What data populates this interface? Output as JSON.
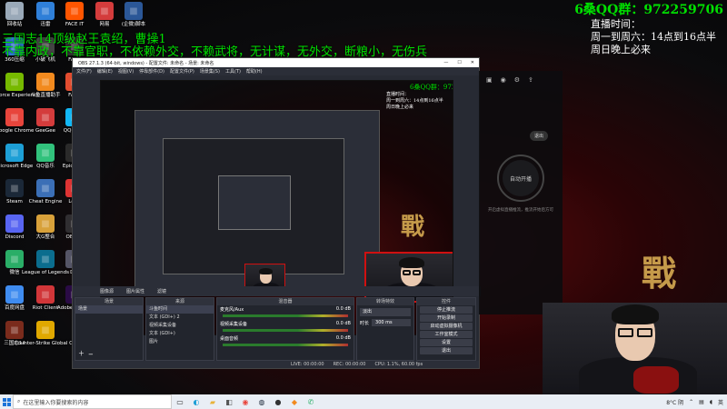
{
  "overlay": {
    "qq_group": "6桑QQ群：972259706",
    "schedule": [
      "直播时间：",
      "周一到周六：14点到16点半",
      "周日晚上必来"
    ],
    "banner_line1": "三国志14顶级赵王袁绍，曹操1",
    "banner_line2": "不靠内政，不靠官职，不依赖外交，不赖武将，无计谋，无外交，断粮小，无伤兵"
  },
  "desktop_icons": {
    "col1": [
      {
        "label": "回收站",
        "icon": "recycle-bin-icon",
        "color": "#9aa9b8"
      },
      {
        "label": "360压缩",
        "icon": "archive-icon",
        "color": "#2f7fd8"
      },
      {
        "label": "GeForce Experience",
        "icon": "geforce-icon",
        "color": "#76b900"
      },
      {
        "label": "Google Chrome",
        "icon": "chrome-icon",
        "color": "#e8453c"
      },
      {
        "label": "Microsoft Edge",
        "icon": "edge-icon",
        "color": "#1d9fd6"
      },
      {
        "label": "Steam",
        "icon": "steam-icon",
        "color": "#1b2838"
      },
      {
        "label": "Discord",
        "icon": "discord-icon",
        "color": "#5865f2"
      },
      {
        "label": "微信",
        "icon": "wechat-icon",
        "color": "#2aae67"
      },
      {
        "label": "百度网盘",
        "icon": "baidu-netdisk-icon",
        "color": "#3f8cf0"
      },
      {
        "label": "三国志14",
        "icon": "game-icon",
        "color": "#7a2b1c"
      }
    ],
    "col2": [
      {
        "label": "迅雷",
        "icon": "thunder-icon",
        "color": "#2f7fd8"
      },
      {
        "label": "小破飞机",
        "icon": "plane-icon",
        "color": "#444"
      },
      {
        "label": "斗鱼直播助手",
        "icon": "douyu-icon",
        "color": "#f28a1e"
      },
      {
        "label": "GeeGee",
        "icon": "geegee-icon",
        "color": "#d43c3c"
      },
      {
        "label": "QQ音乐",
        "icon": "qqmusic-icon",
        "color": "#31c27c"
      },
      {
        "label": "Cheat Engine",
        "icon": "cheat-engine-icon",
        "color": "#3b6fb6"
      },
      {
        "label": "大G整合",
        "icon": "tool-icon",
        "color": "#d8a13a"
      },
      {
        "label": "League of Legends",
        "icon": "lol-icon",
        "color": "#0b6d8e"
      },
      {
        "label": "Riot Client",
        "icon": "riot-icon",
        "color": "#d13639"
      },
      {
        "label": "Counter-Strike Global Off",
        "icon": "cs-icon",
        "color": "#e0a800"
      }
    ],
    "col3": [
      {
        "label": "FACE IT",
        "icon": "faceit-icon",
        "color": "#ff5500"
      },
      {
        "label": "FACE",
        "icon": "app-icon",
        "color": "#333"
      },
      {
        "label": "FACE",
        "icon": "app-icon",
        "color": "#e24c2f"
      },
      {
        "label": "QQ 2020",
        "icon": "qq-icon",
        "color": "#12b7f5"
      },
      {
        "label": "Epic Gam",
        "icon": "epic-icon",
        "color": "#2a2a2a"
      },
      {
        "label": "Loop",
        "icon": "loop-icon",
        "color": "#d33"
      },
      {
        "label": "OBS St",
        "icon": "obs-icon",
        "color": "#302e31"
      },
      {
        "label": "Dor",
        "icon": "app-icon",
        "color": "#556"
      },
      {
        "label": "Adobe Premie",
        "icon": "premiere-icon",
        "color": "#2a0b45"
      }
    ],
    "row_top": [
      {
        "label": "网易",
        "icon": "netease-icon",
        "color": "#d43c3c"
      },
      {
        "label": "(企微)脚本",
        "icon": "word-icon",
        "color": "#2b5797"
      }
    ]
  },
  "obs": {
    "title": "OBS 27.1.3 (64-bit, windows) - 配置文件: 未命名 - 场景: 未命名",
    "menu": [
      "文件(F)",
      "编辑(E)",
      "视图(V)",
      "停靠部件(D)",
      "配置文件(P)",
      "场景集(S)",
      "工具(T)",
      "帮助(H)"
    ],
    "source_toolbar": [
      "图片属性",
      "滤镜",
      "图像源"
    ],
    "scenes_header": "场景",
    "scenes": [
      "场景"
    ],
    "sources_header": "来源",
    "sources": [
      "斗鱼时间",
      "文本 (GDI+) 2",
      "视频采集设备",
      "文本 (GDI+)",
      "图片"
    ],
    "mixer_header": "混音器",
    "mixer": [
      {
        "name": "麦克风/Aux",
        "db": "0.0 dB"
      },
      {
        "name": "视频采集设备",
        "db": "0.0 dB"
      },
      {
        "name": "桌面音频",
        "db": "0.0 dB"
      }
    ],
    "transitions_header": "转场特效",
    "transition_value": "淡出",
    "duration_label": "时长",
    "duration_value": "300 ms",
    "controls_header": "控件",
    "controls": [
      "停止推流",
      "开始录制",
      "启动虚拟摄像机",
      "工作室模式",
      "设置",
      "退出"
    ],
    "status": [
      "LIVE: 00:00:00",
      "REC: 00:00:00",
      "CPU: 1.1%, 60.00 fps"
    ]
  },
  "douyu_panel": {
    "stop_label": "退出",
    "center_label": "自动开播",
    "desc": "开启虚拟直播推流，推流开始后方可"
  },
  "taskbar": {
    "search_placeholder": "在这里输入你要搜索的内容",
    "tray_temp": "8°C 阴",
    "tray_lang": "英"
  }
}
